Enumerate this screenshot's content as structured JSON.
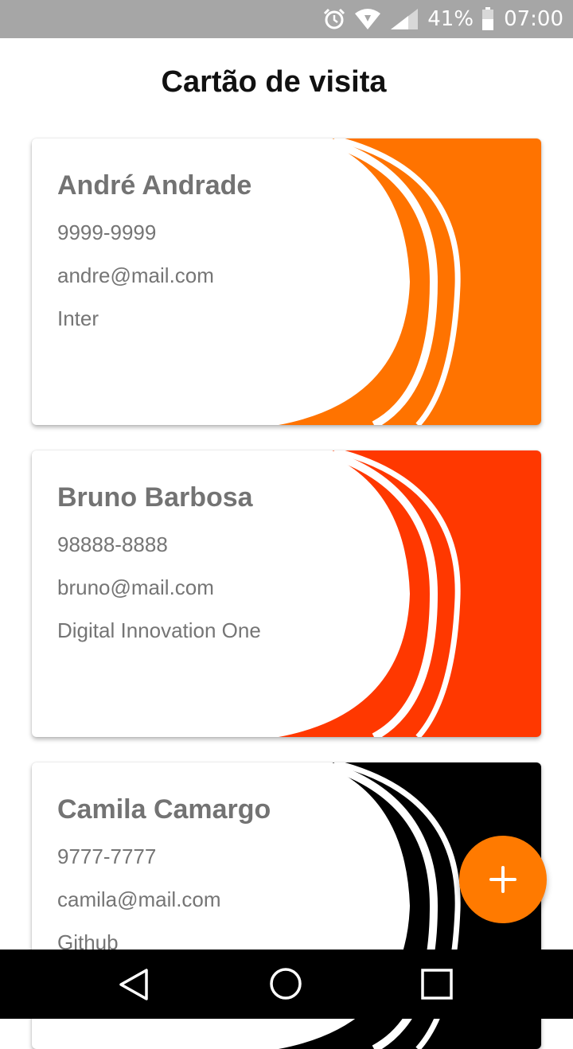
{
  "status_bar": {
    "battery": "41%",
    "time": "07:00",
    "icons": [
      "alarm-icon",
      "wifi-icon",
      "signal-icon",
      "battery-icon"
    ]
  },
  "title": "Cartão de visita",
  "cards": [
    {
      "name": "André Andrade",
      "phone": "9999-9999",
      "email": "andre@mail.com",
      "company": "Inter",
      "color": "#ff7300"
    },
    {
      "name": "Bruno Barbosa",
      "phone": "98888-8888",
      "email": "bruno@mail.com",
      "company": "Digital Innovation One",
      "color": "#ff3800"
    },
    {
      "name": "Camila Camargo",
      "phone": "9777-7777",
      "email": "camila@mail.com",
      "company": "Github",
      "color": "#000000"
    }
  ],
  "fab": {
    "icon": "plus-icon",
    "color": "#ff7a00"
  },
  "nav_bar": {
    "icons": [
      "back-icon",
      "home-icon",
      "recents-icon"
    ]
  }
}
